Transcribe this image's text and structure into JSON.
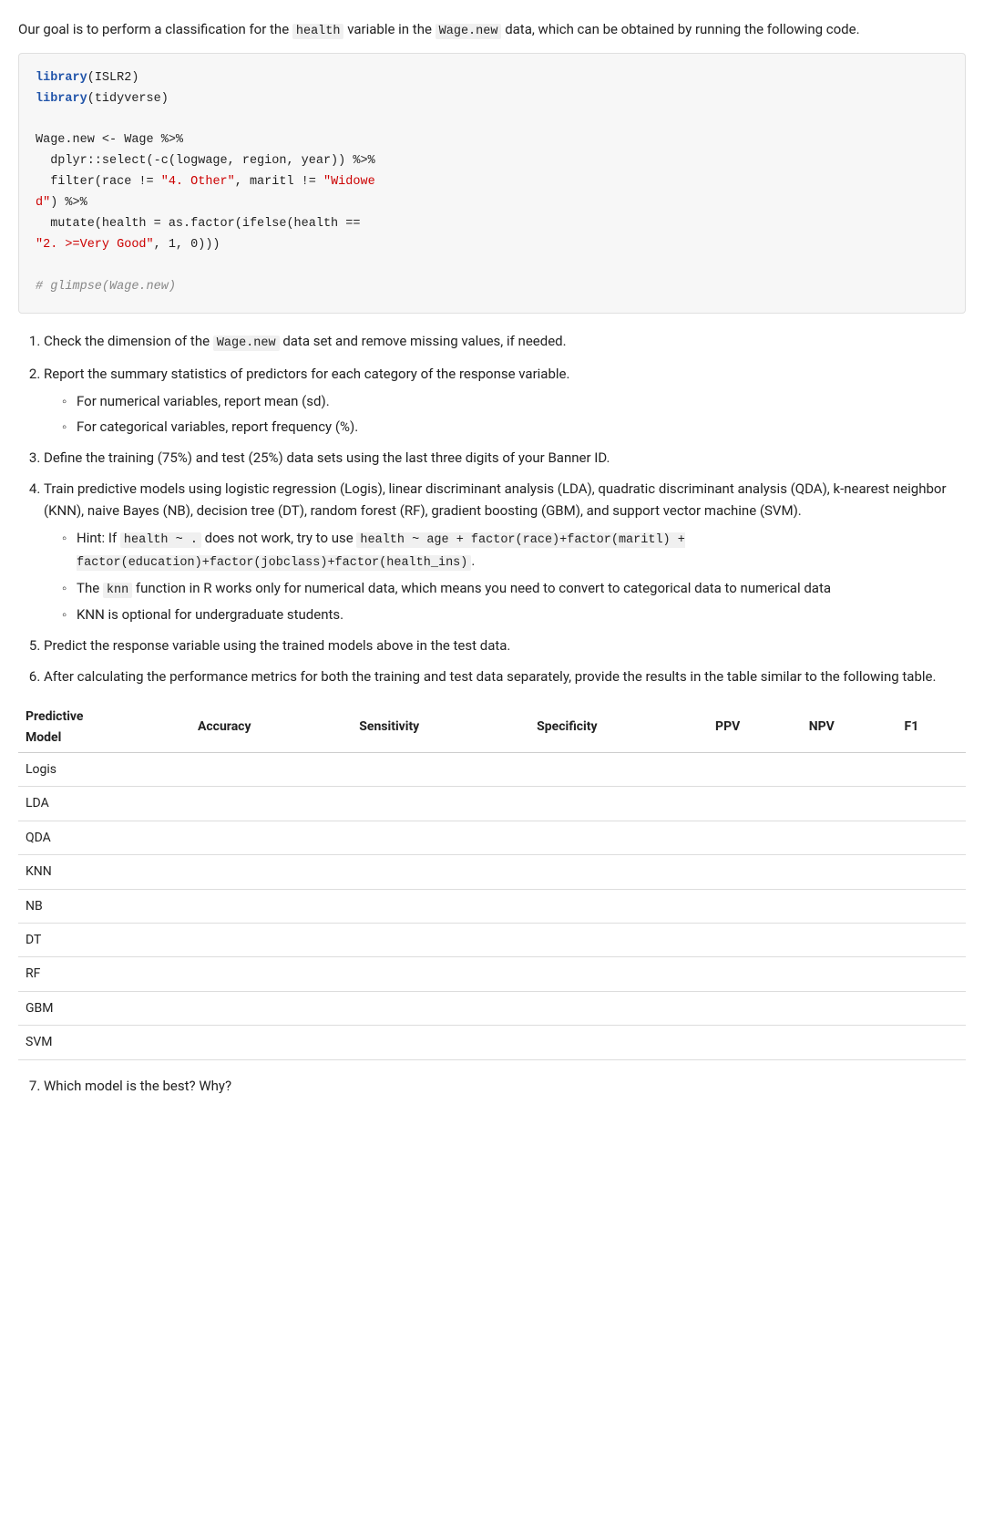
{
  "intro": {
    "text1": "Our goal is to perform a classification for the ",
    "var1": "health",
    "text2": " variable in the ",
    "var2": "Wage.new",
    "text3": " data, which can be obtained by running the following code."
  },
  "code": {
    "line1_kw": "library",
    "line1_arg": "(ISLR2)",
    "line2_kw": "library",
    "line2_arg": "(tidyverse)",
    "line3": "",
    "line4": "Wage.new <- Wage %>%",
    "line5": "  dplyr::select(-c(logwage, region, year)) %>%",
    "line6_pre": "  filter(race != ",
    "line6_str1": "\"4. Other\"",
    "line6_mid": ", maritl != ",
    "line6_str2": "\"Widowe",
    "line7": "d\") %>%",
    "line8_pre": "  mutate(health = as.factor(ifelse(health ==",
    "line9_str": "\"2. >=Very Good\"",
    "line9_mid": ", 1, 0)))",
    "line10": "",
    "comment": "# glimpse(Wage.new)"
  },
  "tasks": {
    "items": [
      {
        "id": "1",
        "text": "Check the dimension of the ",
        "code": "Wage.new",
        "text2": " data set and remove missing values, if needed."
      },
      {
        "id": "2",
        "text": "Report the summary statistics of predictors for each category of the response variable.",
        "subitems": [
          "For numerical variables, report mean (sd).",
          "For categorical variables, report frequency (%)."
        ]
      },
      {
        "id": "3",
        "text": "Define the training (75%) and test (25%) data sets using the last three digits of your Banner ID."
      },
      {
        "id": "4",
        "text": "Train predictive models using logistic regression (Logis), linear discriminant analysis (LDA), quadratic discriminant analysis (QDA), k-nearest neighbor (KNN), naive Bayes (NB), decision tree (DT), random forest (RF), gradient boosting (GBM), and support vector machine (SVM).",
        "subitems": [
          {
            "type": "hint",
            "text": "Hint: If ",
            "code1": "health ~ .",
            "text2": " does not work, try to use",
            "code2": "health ~ age + factor(race)+factor(maritl) + factor(education)+factor(jobclass)+factor(health_ins)."
          },
          {
            "type": "knn",
            "text": "The ",
            "code": "knn",
            "text2": " function in R works only for numerical data, which means you need to convert to categorical data to numerical data"
          },
          {
            "type": "plain",
            "text": "KNN is optional for undergraduate students."
          }
        ]
      },
      {
        "id": "5",
        "text": "Predict the response variable using the trained models above in the test data."
      },
      {
        "id": "6",
        "text": "After calculating the performance metrics for both the training and test data separately, provide the results in the table similar to the following table."
      }
    ]
  },
  "table": {
    "title_line1": "Predictive",
    "title_line2": "Model",
    "headers": [
      "Accuracy",
      "Sensitivity",
      "Specificity",
      "PPV",
      "NPV",
      "F1"
    ],
    "rows": [
      {
        "model": "Logis"
      },
      {
        "model": "LDA"
      },
      {
        "model": "QDA"
      },
      {
        "model": "KNN"
      },
      {
        "model": "NB"
      },
      {
        "model": "DT"
      },
      {
        "model": "RF"
      },
      {
        "model": "GBM"
      },
      {
        "model": "SVM"
      }
    ]
  },
  "question7": {
    "id": "7",
    "text": "Which model is the best? Why?"
  }
}
